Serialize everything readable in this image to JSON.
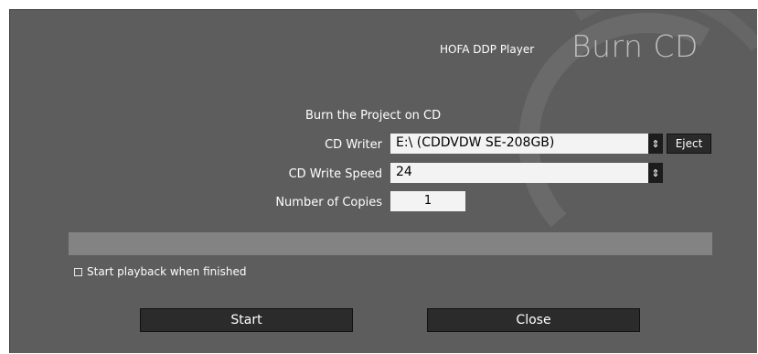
{
  "header": {
    "brand": "HOFA DDP Player",
    "title": "Burn CD"
  },
  "form": {
    "heading": "Burn the Project on CD",
    "writer_label": "CD Writer",
    "writer_value": "E:\\ (CDDVDW SE-208GB)",
    "eject_label": "Eject",
    "speed_label": "CD Write Speed",
    "speed_value": "24",
    "copies_label": "Number of Copies",
    "copies_value": "1"
  },
  "progress": {
    "value": 0
  },
  "options": {
    "playback_label": "Start playback when finished",
    "playback_checked": false
  },
  "buttons": {
    "start": "Start",
    "close": "Close"
  },
  "colors": {
    "background": "#5d5d5d",
    "field": "#f3f3f3",
    "button": "#2b2b2b",
    "progress": "#838383"
  }
}
